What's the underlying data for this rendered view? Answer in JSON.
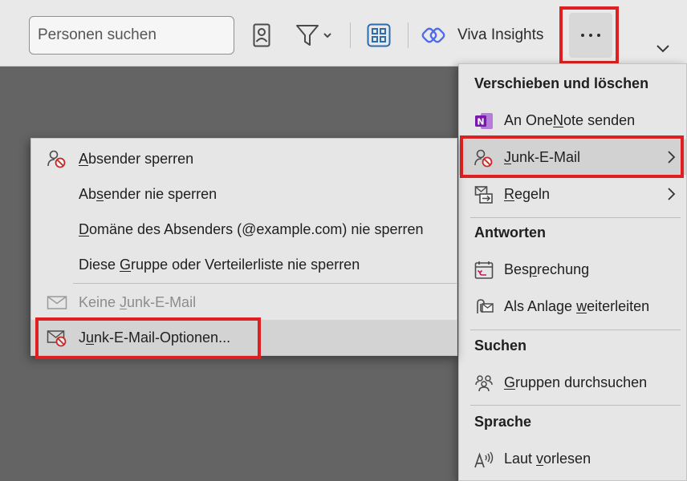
{
  "toolbar": {
    "search_placeholder": "Personen suchen",
    "viva_label": "Viva Insights",
    "icons": [
      "contact-card-icon",
      "filter-icon",
      "apps-grid-icon",
      "viva-insights-icon",
      "more-options-icon",
      "expand-ribbon-icon"
    ]
  },
  "right_menu": {
    "sections": [
      {
        "header": "Verschieben und löschen",
        "items": [
          {
            "pre": "An One",
            "key": "N",
            "post": "ote senden",
            "icon": "onenote-icon",
            "has_submenu": false
          },
          {
            "pre": "",
            "key": "J",
            "post": "unk-E-Mail",
            "icon": "junk-icon",
            "has_submenu": true
          },
          {
            "pre": "",
            "key": "R",
            "post": "egeln",
            "icon": "rules-icon",
            "has_submenu": true
          }
        ]
      },
      {
        "header": "Antworten",
        "items": [
          {
            "pre": "Bes",
            "key": "p",
            "post": "rechung",
            "icon": "meeting-reply-icon",
            "has_submenu": false
          },
          {
            "pre": "Als Anlage ",
            "key": "w",
            "post": "eiterleiten",
            "icon": "forward-attachment-icon",
            "has_submenu": false
          }
        ]
      },
      {
        "header": "Suchen",
        "items": [
          {
            "pre": "",
            "key": "G",
            "post": "ruppen durchsuchen",
            "icon": "group-search-icon",
            "has_submenu": false
          }
        ]
      },
      {
        "header": "Sprache",
        "items": [
          {
            "pre": "Laut ",
            "key": "v",
            "post": "orlesen",
            "icon": "read-aloud-icon",
            "has_submenu": false
          }
        ]
      }
    ]
  },
  "junk_submenu": {
    "items": [
      {
        "pre": "",
        "key": "A",
        "post": "bsender sperren",
        "icon": "block-sender-icon",
        "disabled": false
      },
      {
        "pre": "Ab",
        "key": "s",
        "post": "ender nie sperren",
        "icon": "",
        "disabled": false
      },
      {
        "pre": "",
        "key": "D",
        "post": "omäne des Absenders (@example.com) nie sperren",
        "icon": "",
        "disabled": false
      },
      {
        "pre": "Diese ",
        "key": "G",
        "post": "ruppe oder Verteilerliste nie sperren",
        "icon": "",
        "disabled": false
      },
      {
        "pre": "Keine ",
        "key": "J",
        "post": "unk-E-Mail",
        "icon": "mail-icon",
        "disabled": true
      },
      {
        "pre": "J",
        "key": "u",
        "post": "nk-E-Mail-Optionen...",
        "icon": "junk-options-icon",
        "disabled": false
      }
    ]
  },
  "colors": {
    "highlight": "#e02020",
    "onenote": "#7719aa",
    "viva": "#4f6bed",
    "apps": "#2b6cb0"
  }
}
